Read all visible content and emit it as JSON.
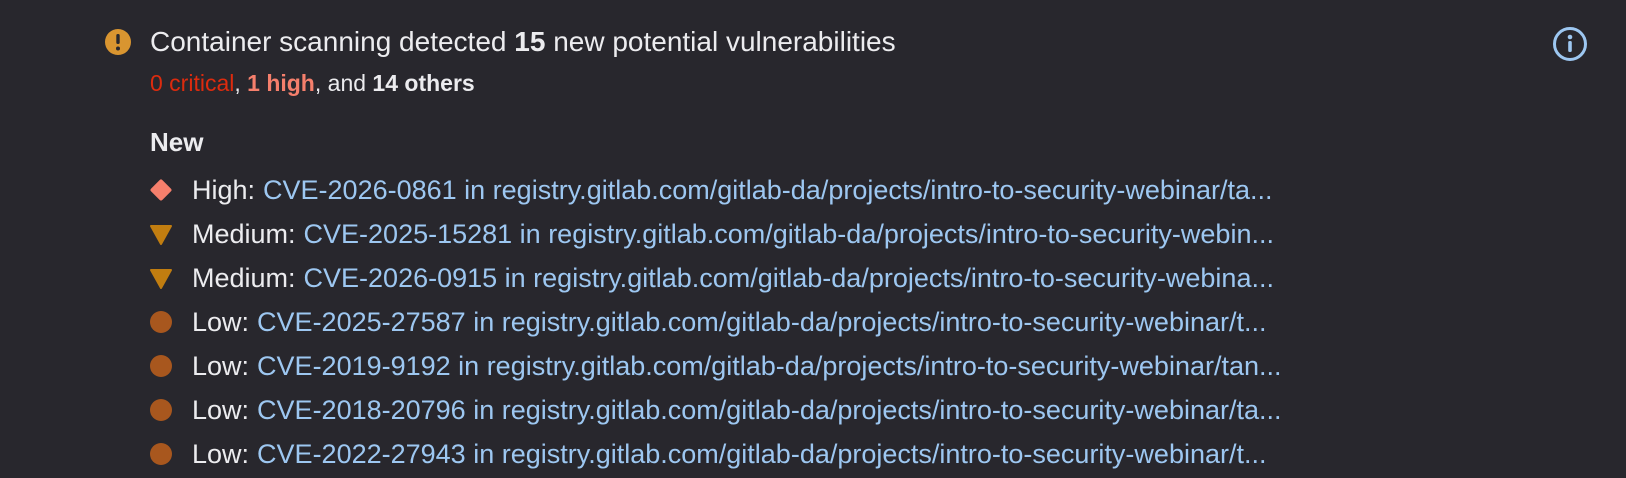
{
  "widget": {
    "title_prefix": "Container scanning detected",
    "title_count": "15",
    "title_suffix": "new potential vulnerabilities",
    "summary": {
      "critical": "0 critical",
      "sep1": ",",
      "high": "1 high",
      "sep2": ", and",
      "others": "14 others"
    },
    "info_icon": "info-circle-icon",
    "status_icon": "warning-circle-icon"
  },
  "section": {
    "heading": "New"
  },
  "vulnerabilities": [
    {
      "severity": "High:",
      "icon": "severity-high-icon",
      "text": "CVE-2026-0861 in registry.gitlab.com/gitlab-da/projects/intro-to-security-webinar/ta..."
    },
    {
      "severity": "Medium:",
      "icon": "severity-medium-icon",
      "text": "CVE-2025-15281 in registry.gitlab.com/gitlab-da/projects/intro-to-security-webin..."
    },
    {
      "severity": "Medium:",
      "icon": "severity-medium-icon",
      "text": "CVE-2026-0915 in registry.gitlab.com/gitlab-da/projects/intro-to-security-webina..."
    },
    {
      "severity": "Low:",
      "icon": "severity-low-icon",
      "text": "CVE-2025-27587 in registry.gitlab.com/gitlab-da/projects/intro-to-security-webinar/t..."
    },
    {
      "severity": "Low:",
      "icon": "severity-low-icon",
      "text": "CVE-2019-9192 in registry.gitlab.com/gitlab-da/projects/intro-to-security-webinar/tan..."
    },
    {
      "severity": "Low:",
      "icon": "severity-low-icon",
      "text": "CVE-2018-20796 in registry.gitlab.com/gitlab-da/projects/intro-to-security-webinar/ta..."
    },
    {
      "severity": "Low:",
      "icon": "severity-low-icon",
      "text": "CVE-2022-27943 in registry.gitlab.com/gitlab-da/projects/intro-to-security-webinar/t..."
    }
  ],
  "colors": {
    "background": "#28272d",
    "text": "#ececef",
    "link": "#9dc7f1",
    "critical": "#dd2b0e",
    "high": "#f57f6c",
    "medium": "#c17d10",
    "low": "#a8571e",
    "warning": "#d99530"
  }
}
